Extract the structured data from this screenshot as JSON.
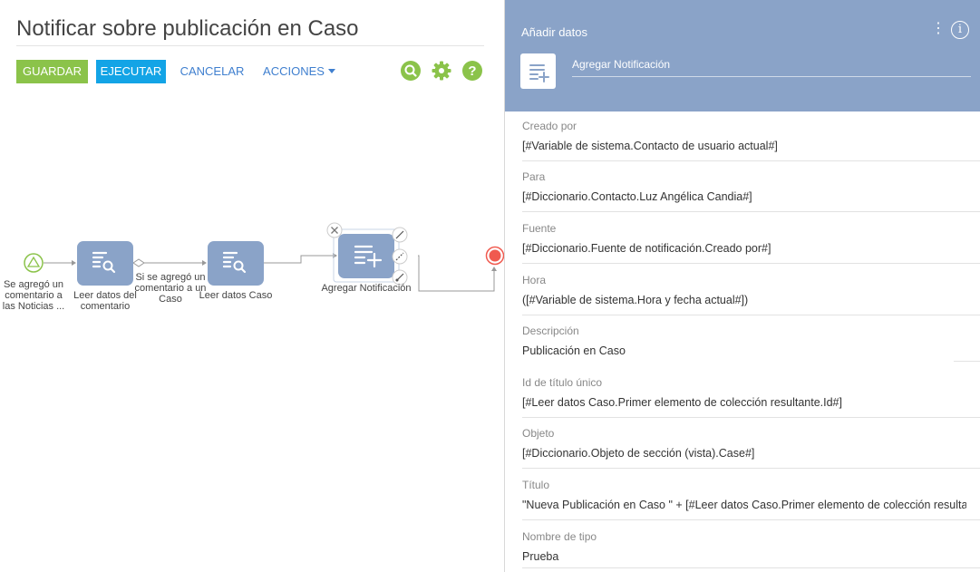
{
  "designer": {
    "title": "Notificar sobre publicación en Caso",
    "buttons": {
      "save": "GUARDAR",
      "run": "EJECUTAR",
      "cancel": "CANCELAR",
      "actions": "ACCIONES"
    },
    "tools": [
      "search-icon",
      "gear-icon",
      "help-icon"
    ],
    "nodes": {
      "start_label_1": "Se agregó un",
      "start_label_2": "comentario a",
      "start_label_3": "las Noticias ...",
      "read_comment_1": "Leer datos del",
      "read_comment_2": "comentario",
      "condition_1": "Si se agregó un",
      "condition_2": "comentario a un",
      "condition_3": "Caso",
      "read_case": "Leer datos Caso",
      "add_notification": "Agregar Notificación"
    }
  },
  "panel": {
    "header_title": "Añadir datos",
    "element_name": "Agregar Notificación",
    "fields": [
      {
        "label": "Creado por",
        "value": "[#Variable de sistema.Contacto de usuario actual#]"
      },
      {
        "label": "Para",
        "value": "[#Diccionario.Contacto.Luz Angélica Candia#]"
      },
      {
        "label": "Fuente",
        "value": "[#Diccionario.Fuente de notificación.Creado por#]"
      },
      {
        "label": "Hora",
        "value": "([#Variable de sistema.Hora y fecha actual#])"
      },
      {
        "label": "Descripción",
        "value": "Publicación en Caso"
      },
      {
        "label": "Id de título único",
        "value": "[#Leer datos Caso.Primer elemento de colección resultante.Id#]"
      },
      {
        "label": "Objeto",
        "value": "[#Diccionario.Objeto de sección (vista).Case#]"
      },
      {
        "label": "Título",
        "value": "\"Nueva Publicación en Caso \" + [#Leer datos Caso.Primer elemento de colección resulta"
      },
      {
        "label": "Nombre de tipo",
        "value": "Prueba"
      }
    ]
  },
  "colors": {
    "save": "#8bc34a",
    "run": "#13a4e6",
    "link": "#3f7fcf",
    "node": "#8aa3c8",
    "panel_header": "#8aa3c8",
    "start": "#8bc34a",
    "end": "#f05a4f"
  }
}
